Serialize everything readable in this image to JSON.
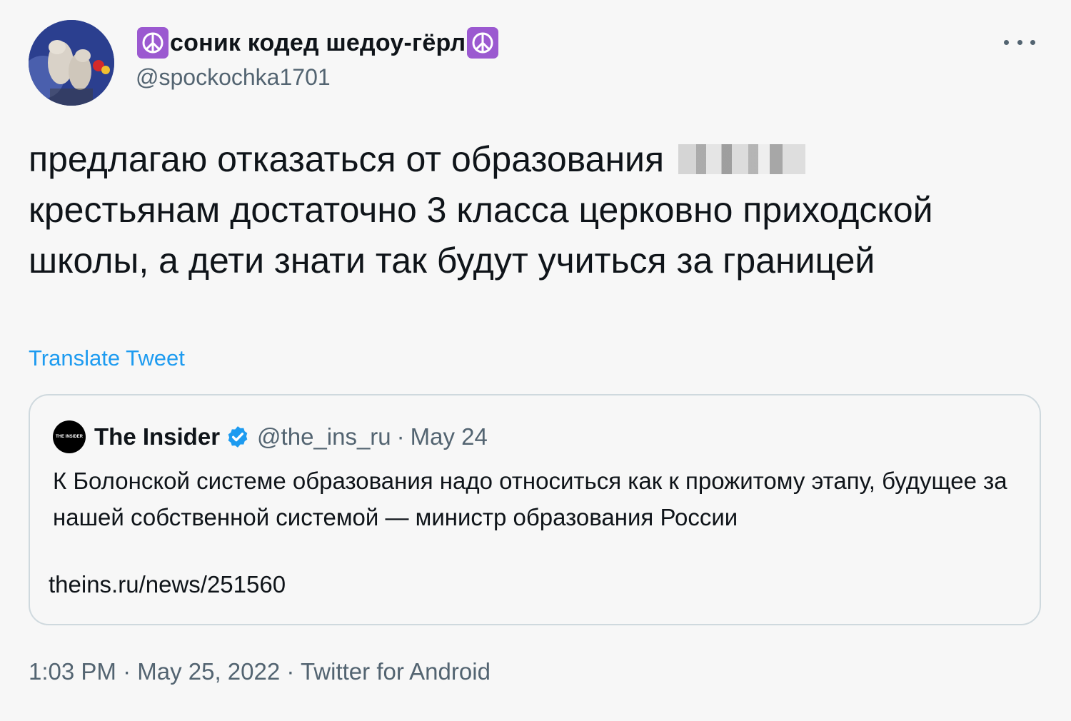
{
  "author": {
    "display_name": "соник кодед шедоу-гёрл",
    "handle": "@spockochka1701",
    "name_emoji": "peace-symbol"
  },
  "tweet": {
    "text_line1": "предлагаю отказаться от образования",
    "text_rest": "крестьянам достаточно 3 класса церковно приходской школы, а дети знати так будут учиться за границей",
    "translate_label": "Translate Tweet"
  },
  "quoted_tweet": {
    "avatar_text": "THE INSIDER",
    "name": "The Insider",
    "handle": "@the_ins_ru",
    "separator": "·",
    "date": "May 24",
    "text": "К Болонской системе образования надо относиться как к прожитому этапу, будущее за нашей собственной системой — министр образования России",
    "link": "theins.ru/news/251560"
  },
  "meta": {
    "time": "1:03 PM",
    "sep1": "·",
    "date": "May 25, 2022",
    "sep2": "·",
    "source": "Twitter for Android"
  },
  "colors": {
    "accent": "#1d9bf0",
    "secondary_text": "#536471",
    "border": "#cfd9de",
    "background": "#f7f7f7",
    "emoji_bg": "#9b59d0"
  }
}
